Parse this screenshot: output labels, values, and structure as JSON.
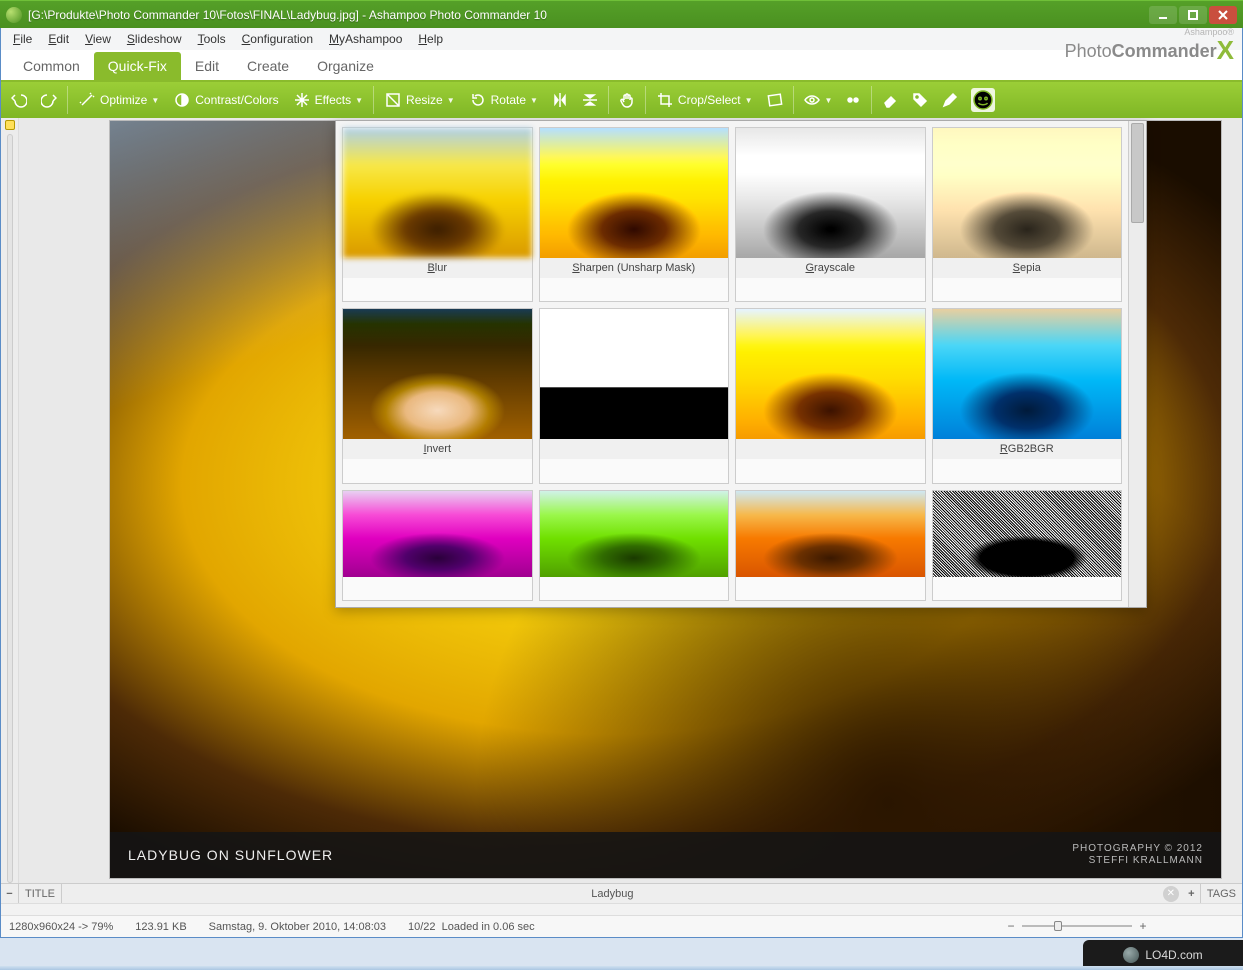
{
  "window": {
    "title": "[G:\\Produkte\\Photo Commander 10\\Fotos\\FINAL\\Ladybug.jpg] - Ashampoo Photo Commander 10"
  },
  "menu": {
    "items": [
      "File",
      "Edit",
      "View",
      "Slideshow",
      "Tools",
      "Configuration",
      "MyAshampoo",
      "Help"
    ]
  },
  "brand": {
    "ash": "Ashampoo®",
    "name_a": "Photo",
    "name_b": "Commander"
  },
  "tabs": {
    "items": [
      "Common",
      "Quick-Fix",
      "Edit",
      "Create",
      "Organize"
    ],
    "active_index": 1
  },
  "toolbar": {
    "optimize": "Optimize",
    "contrast": "Contrast/Colors",
    "effects": "Effects",
    "resize": "Resize",
    "rotate": "Rotate",
    "cropselect": "Crop/Select"
  },
  "photo": {
    "caption": "LADYBUG ON SUNFLOWER",
    "credit_line1": "PHOTOGRAPHY © 2012",
    "credit_line2": "STEFFI KRALLMANN"
  },
  "effects": {
    "items": [
      {
        "label": "Blur",
        "variant": "th-blur th-base"
      },
      {
        "label": "Sharpen (Unsharp Mask)",
        "variant": "th-sharp th-base"
      },
      {
        "label": "Grayscale",
        "variant": "th-gray th-base"
      },
      {
        "label": "Sepia",
        "variant": "th-sepia th-base"
      },
      {
        "label": "Invert",
        "variant": "th-invert th-base"
      },
      {
        "label": "",
        "variant": "th-thresh"
      },
      {
        "label": "",
        "variant": "th-duo"
      },
      {
        "label": "RGB2BGR",
        "variant": "th-rgb2bgr"
      },
      {
        "label": "",
        "variant": "th-magenta",
        "short": true
      },
      {
        "label": "",
        "variant": "th-green",
        "short": true
      },
      {
        "label": "",
        "variant": "th-orange",
        "short": true
      },
      {
        "label": "",
        "variant": "th-dither",
        "short": true
      }
    ]
  },
  "titlebarRow": {
    "label_title": "TITLE",
    "filename": "Ladybug",
    "label_tags": "TAGS"
  },
  "status": {
    "dims": "1280x960x24 -> 79%",
    "size": "123.91 KB",
    "date": "Samstag, 9. Oktober 2010, 14:08:03",
    "index": "10/22",
    "loaded": "Loaded in 0.06 sec"
  },
  "watermark": "LO4D.com"
}
